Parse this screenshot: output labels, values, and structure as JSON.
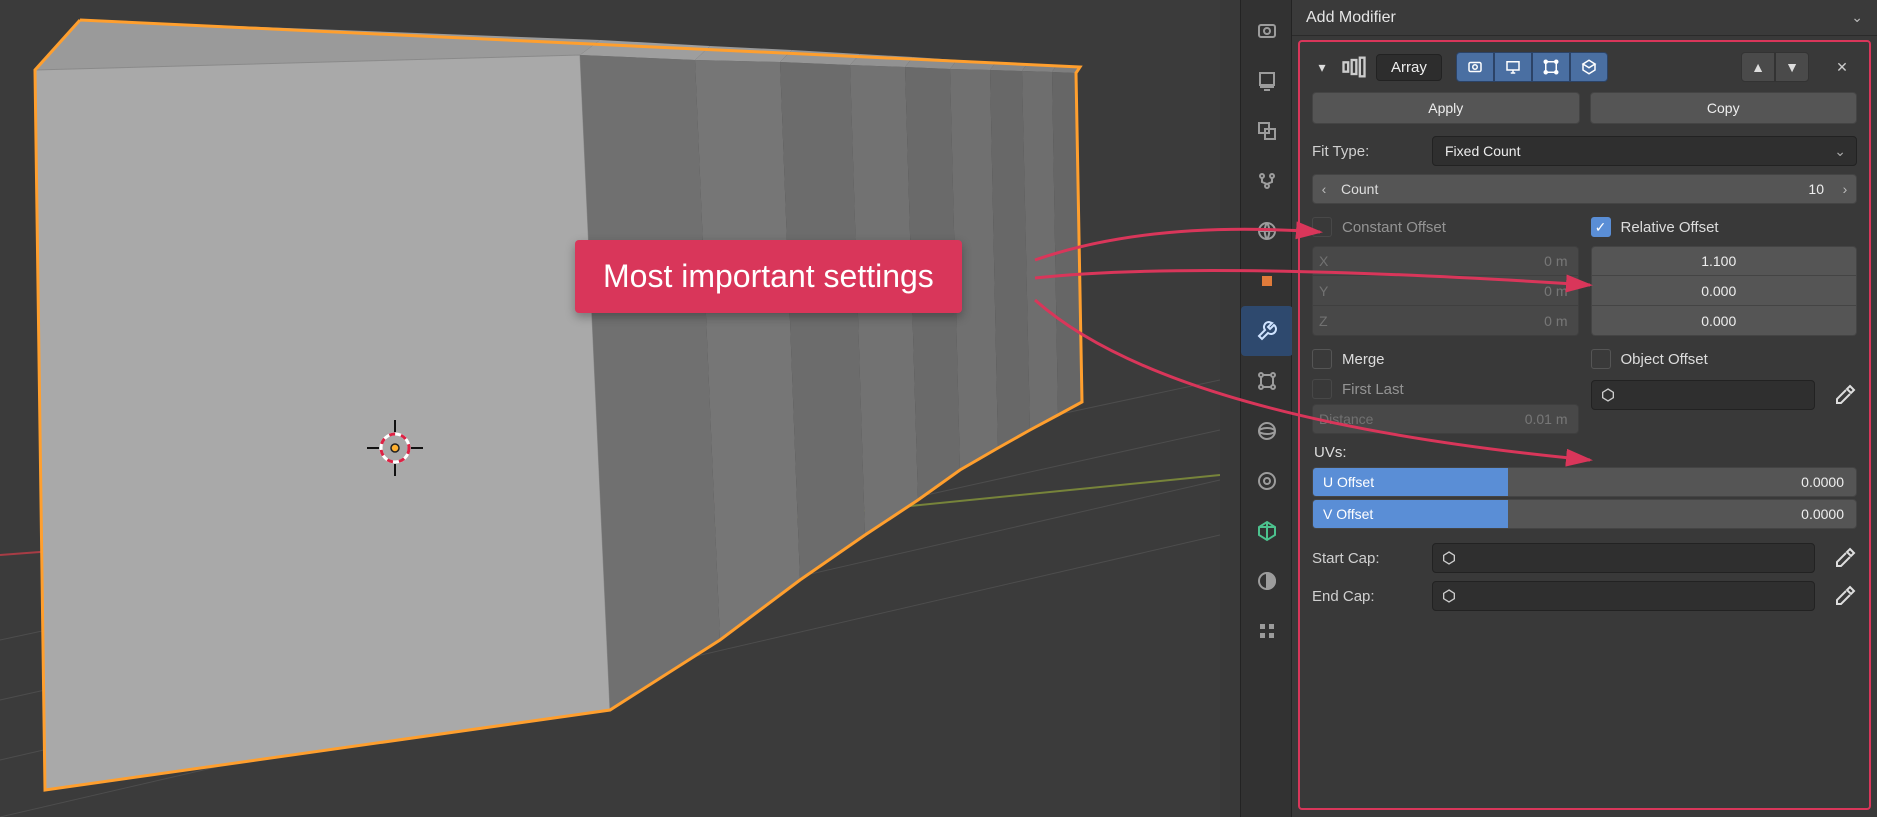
{
  "callout": "Most important settings",
  "header": {
    "title": "Add Modifier"
  },
  "modifier": {
    "name": "Array",
    "apply": "Apply",
    "copy": "Copy",
    "fit_type_label": "Fit Type:",
    "fit_type_value": "Fixed Count",
    "count_label": "Count",
    "count_value": "10",
    "constant_offset": {
      "label": "Constant Offset",
      "checked": false,
      "x": "0 m",
      "y": "0 m",
      "z": "0 m",
      "xl": "X",
      "yl": "Y",
      "zl": "Z"
    },
    "relative_offset": {
      "label": "Relative Offset",
      "checked": true,
      "x": "1.100",
      "y": "0.000",
      "z": "0.000"
    },
    "merge": {
      "label": "Merge",
      "checked": false
    },
    "object_offset": {
      "label": "Object Offset",
      "checked": false
    },
    "first_last": {
      "label": "First Last",
      "checked": false
    },
    "distance_label": "Distance",
    "distance_value": "0.01 m",
    "uvs_label": "UVs:",
    "u_offset_label": "U Offset",
    "u_offset_value": "0.0000",
    "v_offset_label": "V Offset",
    "v_offset_value": "0.0000",
    "start_cap_label": "Start Cap:",
    "end_cap_label": "End Cap:"
  },
  "tabs": [
    "render",
    "output",
    "viewlayer",
    "scene",
    "world",
    "object",
    "modifier",
    "particle",
    "physics",
    "constraint",
    "mesh",
    "material",
    "texture"
  ]
}
